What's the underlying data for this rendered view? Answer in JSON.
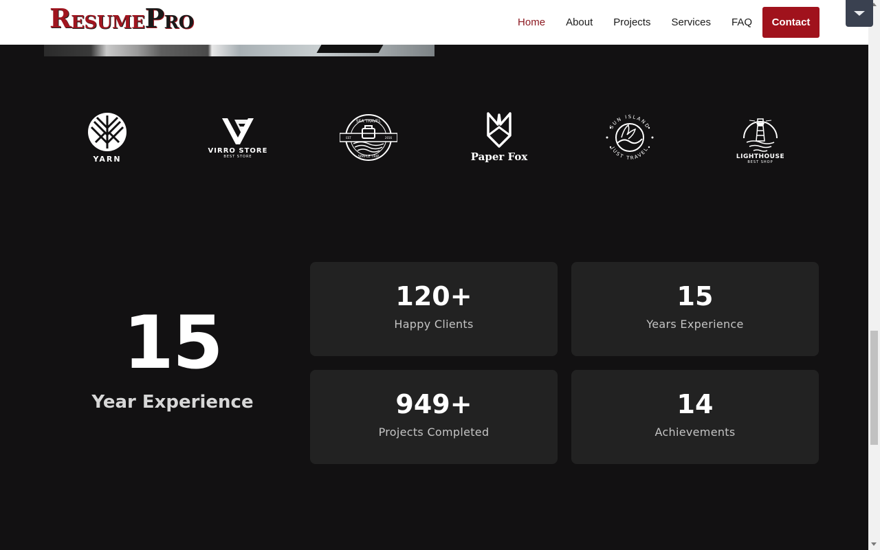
{
  "header": {
    "logo": {
      "part1_big": "R",
      "part1_small": "ESUME",
      "part2_big": "P",
      "part2_small": "RO"
    },
    "nav": [
      {
        "label": "Home",
        "active": true
      },
      {
        "label": "About",
        "active": false
      },
      {
        "label": "Projects",
        "active": false
      },
      {
        "label": "Services",
        "active": false
      },
      {
        "label": "FAQ",
        "active": false
      }
    ],
    "cta_label": "Contact"
  },
  "colors": {
    "brand_red": "#a0121c",
    "nav_active": "#8c1820",
    "background": "#121112",
    "card": "#222222"
  },
  "brands": [
    {
      "name": "YARN",
      "sub": ""
    },
    {
      "name": "VIRRO STORE",
      "sub": "BEST STORE"
    },
    {
      "name": "SEA TRAVEL",
      "sub": "SIMPLE TRIP",
      "est": "EST",
      "year": "2016"
    },
    {
      "name": "Paper Fox",
      "sub": ""
    },
    {
      "name": "SUN ISLAND",
      "sub": "JUST TRAVEL"
    },
    {
      "name": "LIGHTHOUSE",
      "sub": "BEST SHOP"
    }
  ],
  "experience": {
    "value": "15",
    "label": "Year Experience"
  },
  "stats": [
    {
      "value": "120+",
      "label": "Happy Clients"
    },
    {
      "value": "15",
      "label": "Years Experience"
    },
    {
      "value": "949+",
      "label": "Projects Completed"
    },
    {
      "value": "14",
      "label": "Achievements"
    }
  ]
}
